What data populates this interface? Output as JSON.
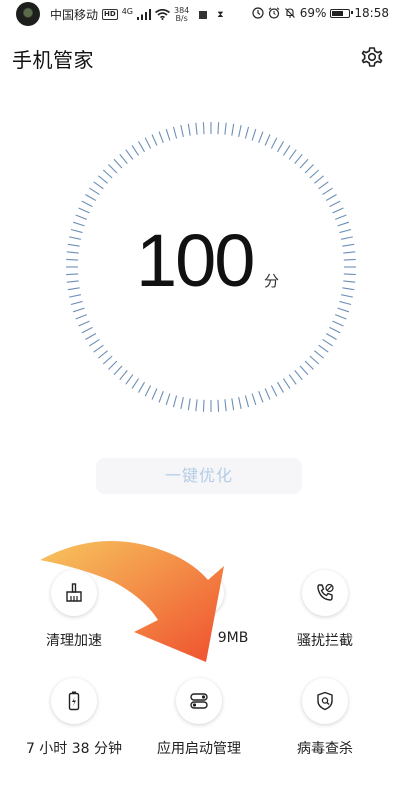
{
  "status_bar": {
    "carrier": "中国移动",
    "hd": "HD",
    "network": "4G",
    "speed_value": "384",
    "speed_unit": "B/s",
    "battery": "69%",
    "battery_level": 0.69,
    "time": "18:58"
  },
  "header": {
    "title": "手机管家",
    "settings_icon": "gear-icon"
  },
  "score": {
    "value": "100",
    "unit": "分"
  },
  "optimize": {
    "label": "一键优化"
  },
  "tiles": [
    {
      "label": "清理加速",
      "icon": "broom-icon"
    },
    {
      "label": "9MB",
      "icon": "data-traffic-icon"
    },
    {
      "label": "骚扰拦截",
      "icon": "blocked-call-icon"
    },
    {
      "label": "7 小时 38 分钟",
      "icon": "battery-charging-icon"
    },
    {
      "label": "应用启动管理",
      "icon": "toggle-switches-icon"
    },
    {
      "label": "病毒查杀",
      "icon": "shield-search-icon"
    }
  ],
  "colors": {
    "ring_ticks": "#6d8fb6",
    "arrow_start": "#f7c65e",
    "arrow_end": "#ef4f2e",
    "optimize_text": "#b4cde6"
  }
}
